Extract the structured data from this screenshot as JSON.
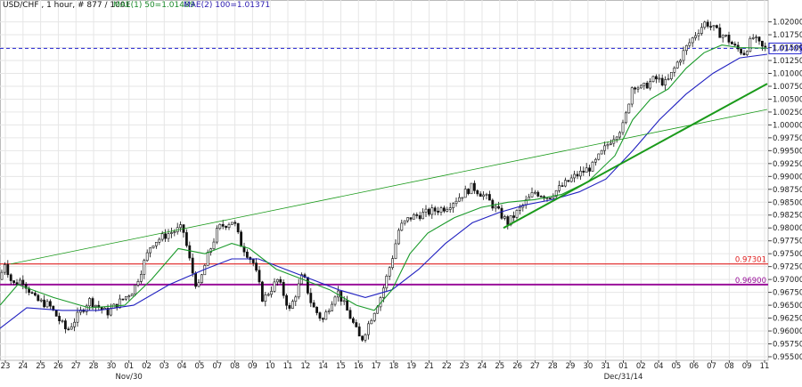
{
  "header": {
    "symbol": "USD/CHF , 1 hour, # 877 / 1001",
    "ma1": "MAE(1) 50=1.01489",
    "ma2": "MAE(2) 100=1.01371",
    "ma1_color": "#1a8a2a",
    "ma2_color": "#2a1ab0"
  },
  "colors": {
    "ma50": "#1a9a2a",
    "ma100": "#2020c0",
    "trendline": "#1a9a1a",
    "resistance": "#e02020",
    "support": "#9a109a",
    "current": "#2020d0",
    "grid": "#e6e6e6"
  },
  "chart_data": {
    "type": "candlestick",
    "title": "USD/CHF , 1 hour, # 877 / 1001",
    "ylim": [
      0.955,
      1.022
    ],
    "y_ticks": [
      "1.02000",
      "1.01750",
      "1.01500",
      "1.01250",
      "1.01000",
      "1.00750",
      "1.00500",
      "1.00250",
      "1.00000",
      "0.99750",
      "0.99500",
      "0.99250",
      "0.99000",
      "0.98750",
      "0.98500",
      "0.98250",
      "0.98000",
      "0.97750",
      "0.97500",
      "0.97250",
      "0.97000",
      "0.96750",
      "0.96500",
      "0.96250",
      "0.96000",
      "0.95750",
      "0.95500"
    ],
    "x_labels": [
      "23",
      "24",
      "25",
      "26",
      "27",
      "28",
      "30",
      "01",
      "02",
      "03",
      "04",
      "05",
      "07",
      "08",
      "09",
      "10",
      "11",
      "12",
      "14",
      "15",
      "16",
      "17",
      "18",
      "19",
      "21",
      "22",
      "23",
      "24",
      "25",
      "26",
      "27",
      "28",
      "29",
      "30",
      "31",
      "01",
      "02",
      "04",
      "05",
      "06",
      "07",
      "08",
      "09",
      "11"
    ],
    "date_labels": [
      "Nov/30",
      "Dec/31/14"
    ],
    "price_path": [
      [
        0,
        0.97
      ],
      [
        5,
        0.9735
      ],
      [
        14,
        0.969
      ],
      [
        25,
        0.97
      ],
      [
        40,
        0.966
      ],
      [
        55,
        0.965
      ],
      [
        75,
        0.96
      ],
      [
        100,
        0.966
      ],
      [
        120,
        0.9635
      ],
      [
        150,
        0.968
      ],
      [
        170,
        0.977
      ],
      [
        190,
        0.979
      ],
      [
        205,
        0.98
      ],
      [
        215,
        0.972
      ],
      [
        222,
        0.968
      ],
      [
        232,
        0.974
      ],
      [
        245,
        0.98
      ],
      [
        262,
        0.9815
      ],
      [
        270,
        0.977
      ],
      [
        285,
        0.973
      ],
      [
        295,
        0.966
      ],
      [
        312,
        0.97
      ],
      [
        325,
        0.964
      ],
      [
        340,
        0.971
      ],
      [
        350,
        0.965
      ],
      [
        362,
        0.962
      ],
      [
        378,
        0.968
      ],
      [
        395,
        0.962
      ],
      [
        405,
        0.958
      ],
      [
        415,
        0.962
      ],
      [
        428,
        0.967
      ],
      [
        440,
        0.974
      ],
      [
        448,
        0.98
      ],
      [
        460,
        0.982
      ],
      [
        480,
        0.983
      ],
      [
        500,
        0.984
      ],
      [
        515,
        0.986
      ],
      [
        530,
        0.988
      ],
      [
        545,
        0.986
      ],
      [
        560,
        0.983
      ],
      [
        570,
        0.981
      ],
      [
        585,
        0.984
      ],
      [
        600,
        0.987
      ],
      [
        615,
        0.986
      ],
      [
        630,
        0.988
      ],
      [
        645,
        0.99
      ],
      [
        665,
        0.992
      ],
      [
        685,
        0.997
      ],
      [
        700,
        1.0
      ],
      [
        710,
        1.008
      ],
      [
        720,
        1.007
      ],
      [
        735,
        1.009
      ],
      [
        748,
        1.008
      ],
      [
        760,
        1.012
      ],
      [
        770,
        1.015
      ],
      [
        782,
        1.018
      ],
      [
        792,
        1.02
      ],
      [
        805,
        1.018
      ],
      [
        815,
        1.017
      ],
      [
        825,
        1.015
      ],
      [
        835,
        1.014
      ],
      [
        845,
        1.017
      ],
      [
        855,
        1.015
      ],
      [
        861,
        1.0149
      ]
    ],
    "ma50_path": [
      [
        0,
        0.965
      ],
      [
        20,
        0.969
      ],
      [
        60,
        0.9665
      ],
      [
        100,
        0.9645
      ],
      [
        140,
        0.965
      ],
      [
        170,
        0.97
      ],
      [
        200,
        0.976
      ],
      [
        230,
        0.975
      ],
      [
        260,
        0.977
      ],
      [
        280,
        0.976
      ],
      [
        310,
        0.972
      ],
      [
        340,
        0.97
      ],
      [
        370,
        0.968
      ],
      [
        400,
        0.965
      ],
      [
        420,
        0.964
      ],
      [
        440,
        0.968
      ],
      [
        460,
        0.975
      ],
      [
        480,
        0.979
      ],
      [
        510,
        0.982
      ],
      [
        540,
        0.984
      ],
      [
        570,
        0.985
      ],
      [
        600,
        0.9855
      ],
      [
        630,
        0.9865
      ],
      [
        660,
        0.989
      ],
      [
        690,
        0.994
      ],
      [
        710,
        1.001
      ],
      [
        730,
        1.005
      ],
      [
        750,
        1.007
      ],
      [
        770,
        1.011
      ],
      [
        790,
        1.014
      ],
      [
        810,
        1.0155
      ],
      [
        830,
        1.015
      ],
      [
        861,
        1.01489
      ]
    ],
    "ma100_path": [
      [
        0,
        0.9605
      ],
      [
        30,
        0.9645
      ],
      [
        70,
        0.964
      ],
      [
        110,
        0.964
      ],
      [
        150,
        0.965
      ],
      [
        190,
        0.969
      ],
      [
        230,
        0.972
      ],
      [
        260,
        0.974
      ],
      [
        290,
        0.974
      ],
      [
        320,
        0.972
      ],
      [
        350,
        0.97
      ],
      [
        380,
        0.968
      ],
      [
        410,
        0.9665
      ],
      [
        440,
        0.968
      ],
      [
        470,
        0.972
      ],
      [
        500,
        0.977
      ],
      [
        530,
        0.981
      ],
      [
        560,
        0.983
      ],
      [
        590,
        0.9845
      ],
      [
        620,
        0.9855
      ],
      [
        650,
        0.987
      ],
      [
        680,
        0.9895
      ],
      [
        710,
        0.995
      ],
      [
        740,
        1.001
      ],
      [
        770,
        1.006
      ],
      [
        800,
        1.01
      ],
      [
        830,
        1.013
      ],
      [
        861,
        1.01371
      ]
    ],
    "horizontal_levels": [
      {
        "name": "resistance",
        "value": 0.97301,
        "label": "0.97301",
        "color": "#e02020"
      },
      {
        "name": "support",
        "value": 0.969,
        "label": "0.96900",
        "color": "#9a109a"
      }
    ],
    "current_price": {
      "value": 1.01485,
      "label": "1.01485"
    },
    "trendlines": [
      {
        "name": "long-trendline",
        "from": [
          12,
          0.973
        ],
        "to": [
          861,
          1.003
        ],
        "width": 0.8
      },
      {
        "name": "short-trendline",
        "from": [
          565,
          0.98
        ],
        "to": [
          861,
          1.008
        ],
        "width": 2
      }
    ]
  }
}
